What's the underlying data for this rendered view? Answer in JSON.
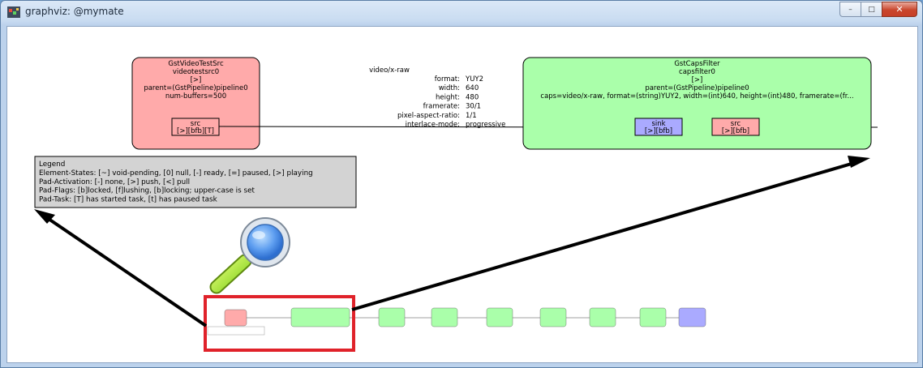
{
  "window": {
    "title": "graphviz: @mymate"
  },
  "controls": {
    "minimize": "–",
    "maximize": "□",
    "close": "✕"
  },
  "source_node": {
    "type": "GstVideoTestSrc",
    "name": "videotestsrc0",
    "state": "[>]",
    "parent": "parent=(GstPipeline)pipeline0",
    "prop": "num-buffers=500",
    "pad_name": "src",
    "pad_flags": "[>][bfb][T]"
  },
  "caps_label": {
    "media": "video/x-raw",
    "rows": [
      {
        "key": "format:",
        "value": "YUY2"
      },
      {
        "key": "width:",
        "value": "640"
      },
      {
        "key": "height:",
        "value": "480"
      },
      {
        "key": "framerate:",
        "value": "30/1"
      },
      {
        "key": "pixel-aspect-ratio:",
        "value": "1/1"
      },
      {
        "key": "interlace-mode:",
        "value": "progressive"
      }
    ]
  },
  "filter_node": {
    "type": "GstCapsFilter",
    "name": "capsfilter0",
    "state": "[>]",
    "parent": "parent=(GstPipeline)pipeline0",
    "caps": "caps=video/x-raw, format=(string)YUY2, width=(int)640, height=(int)480, framerate=(fr...",
    "sink_pad_name": "sink",
    "sink_pad_flags": "[>][bfb]",
    "src_pad_name": "src",
    "src_pad_flags": "[>][bfb]"
  },
  "legend": {
    "title": "Legend",
    "lines": [
      "Element-States: [~] void-pending, [0] null, [-] ready, [=] paused, [>] playing",
      "Pad-Activation: [-] none, [>] push, [<] pull",
      "Pad-Flags: [b]locked, [f]lushing, [b]locking; upper-case is set",
      "Pad-Task: [T] has started task, [t] has paused task"
    ]
  },
  "overview": {
    "nodes": [
      "red",
      "green",
      "green",
      "green",
      "green",
      "green",
      "green",
      "green",
      "blue"
    ],
    "highlight_color": "#e0222a"
  },
  "colors": {
    "source_fill": "#ffaaaa",
    "filter_fill": "#aaffaa",
    "sink_pad_fill": "#aaaaff",
    "legend_fill": "#d3d3d3",
    "highlight": "#e0222a"
  }
}
